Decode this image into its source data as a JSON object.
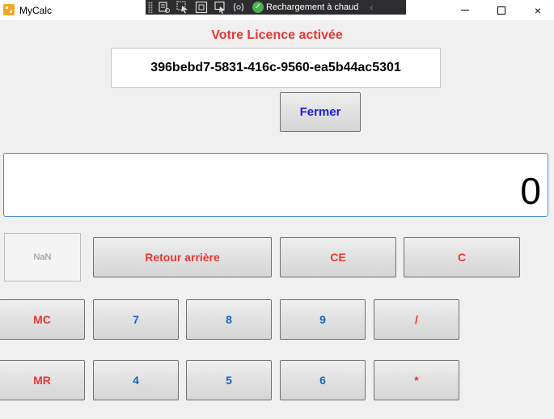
{
  "window": {
    "title": "MyCalc",
    "controls": {
      "minimize": "minimize",
      "maximize": "maximize",
      "close": "×"
    }
  },
  "debug_toolbar": {
    "hot_reload_label": "Rechargement à chaud",
    "icons": [
      "live-visual-tree-icon",
      "select-element-icon",
      "display-adorners-icon",
      "track-focus-icon",
      "binding-failures-icon",
      "hot-reload-check-icon",
      "collapse-chevron-icon"
    ]
  },
  "license": {
    "title": "Votre Licence activée",
    "key": "396bebd7-5831-416c-9560-ea5b44ac5301",
    "close_label": "Fermer"
  },
  "calculator": {
    "display_value": "0",
    "memory_indicator": "NaN",
    "buttons": {
      "backspace": "Retour arrière",
      "ce": "CE",
      "c": "C",
      "mc": "MC",
      "seven": "7",
      "eight": "8",
      "nine": "9",
      "divide": "/",
      "mr": "MR",
      "four": "4",
      "five": "5",
      "six": "6",
      "multiply": "*"
    }
  },
  "colors": {
    "accent_red": "#e53935",
    "digit_blue": "#1565c0",
    "fermer_blue": "#1a1ae6",
    "display_border": "#4a8ad8"
  }
}
